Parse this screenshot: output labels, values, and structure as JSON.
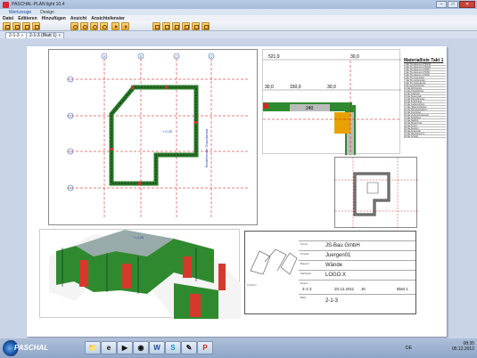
{
  "window": {
    "title": "PASCHAL-PLAN light 10.4",
    "minimize": "–",
    "maximize": "□",
    "close": "✕"
  },
  "ribbon_tabs": [
    "Werkzeuge",
    "Design"
  ],
  "menu": [
    "Datei",
    "Editieren",
    "Hinzufügen",
    "Ansicht",
    "Ansichtsfenster"
  ],
  "toolbar": {
    "icons": [
      "new-icon",
      "close-icon",
      "open-icon",
      "save-icon",
      "zoom-in-icon",
      "zoom-out-icon",
      "zoom-window-icon",
      "zoom-all-icon",
      "undo-icon",
      "redo-icon",
      "layout-1-icon",
      "layout-2-icon",
      "layout-3-icon",
      "layout-4-icon",
      "layout-5-icon",
      "layout-6-icon"
    ]
  },
  "doc_tabs": [
    {
      "label": "2-1-3",
      "close": "x"
    },
    {
      "label": "2-1-3 (Blatt 1)",
      "close": "x"
    }
  ],
  "plan": {
    "axis_letters": [
      "A",
      "B",
      "C",
      "D"
    ],
    "axis_numbers": [
      "1",
      "2",
      "3",
      "4"
    ],
    "level": "+ 0.20",
    "side_label": "Bestehende Grundwand"
  },
  "detail": {
    "dim_top_left": "521,9",
    "dim_top_right": "30,0",
    "dim_row": [
      "30,0",
      "150,0",
      "30,0"
    ],
    "element": "240"
  },
  "material_table": {
    "title": "Materialliste Takt 1",
    "rows": [
      "1 GE Trio Element 270/240",
      "2 GE Trio Element 270/120",
      "3 GE Trio Element 270/90",
      "4 GE Trio Element 270/60",
      "5 GE Trio Element 270/30",
      "6 GE Trio Innenecke",
      "7 GE Trio Außenecke",
      "8 GE Trio Gelenkecke",
      "9 GE Ausgleichsholz",
      "10 GE Richtstütze",
      "11 GE Arbeitsbühne",
      "12 GE Geländer",
      "13 GE Spannstab",
      "14 GE Flanschmutter",
      "15 GE Keilschloss",
      "16 GE Justierschloss",
      "17 GE Hakenschlüssel",
      "18 GE Stirnabschalung",
      "19 GE Kranbügel",
      "20 GE Verbindungsriegel",
      "21 GE Schalhaut",
      "22 GE Stellfuß",
      "23 GE Distanzrohr",
      "24 GE Konus",
      "25 GE Stopfen",
      "26 GE Ankerstab",
      "27 GE Wassersperre",
      "28 GE Schalöl"
    ]
  },
  "title_block": {
    "company": "JS-Bau GmbH",
    "project": "Juergen01",
    "part": "Wände",
    "logo": "LOGO.X",
    "labels": [
      "Datum",
      "Name",
      "Projekt",
      "Bauteil",
      "Maßstab",
      "Blatt"
    ],
    "drawing_no": "2-1-3",
    "date": "20.12.2011",
    "initials": "JK",
    "sheet": "Blatt 1",
    "code": "2-1-3"
  },
  "taskbar": {
    "brand": "PASCHAL",
    "apps": [
      "explorer",
      "ie",
      "media",
      "firefox",
      "word",
      "skype",
      "paint",
      "paschal"
    ],
    "app_glyphs": [
      "📁",
      "e",
      "▶",
      "◉",
      "W",
      "S",
      "✎",
      "P"
    ],
    "lang": "DE",
    "time": "08:35",
    "date": "05.12.2012"
  }
}
